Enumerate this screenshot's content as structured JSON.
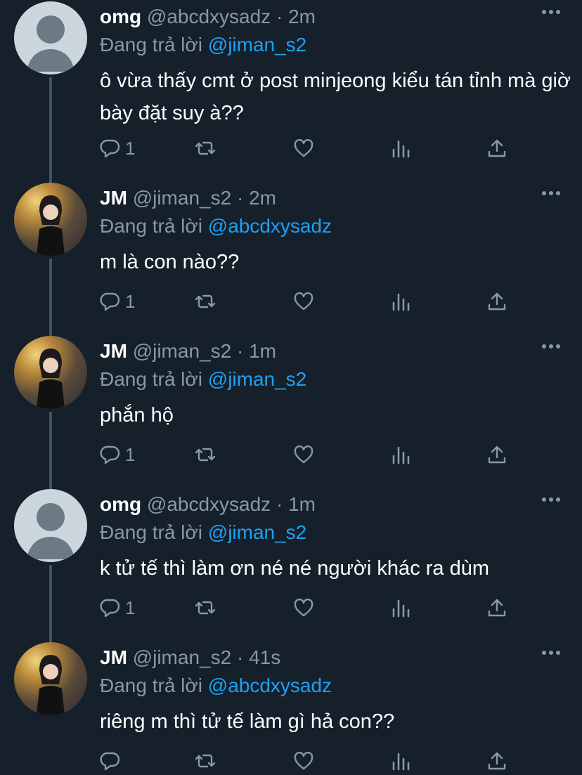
{
  "tweets": [
    {
      "name": "omg",
      "handle": "@abcdxysadz",
      "time": "2m",
      "replying_label": "Đang trả lời",
      "replying_to": "@jiman_s2",
      "text": "ô vừa thấy cmt ở post minjeong kiểu tán tỉnh mà giờ bày đặt suy à??",
      "reply_count": "1",
      "avatar": "default-avatar"
    },
    {
      "name": "JM",
      "handle": "@jiman_s2",
      "time": "2m",
      "replying_label": "Đang trả lời",
      "replying_to": "@abcdxysadz",
      "text": "m là con nào??",
      "reply_count": "1",
      "avatar": "photo-avatar"
    },
    {
      "name": "JM",
      "handle": "@jiman_s2",
      "time": "1m",
      "replying_label": "Đang trả lời",
      "replying_to": "@jiman_s2",
      "text": "phắn hộ",
      "reply_count": "1",
      "avatar": "photo-avatar"
    },
    {
      "name": "omg",
      "handle": "@abcdxysadz",
      "time": "1m",
      "replying_label": "Đang trả lời",
      "replying_to": "@jiman_s2",
      "text": "k tử tế thì làm ơn né né người khác ra dùm",
      "reply_count": "1",
      "avatar": "default-avatar"
    },
    {
      "name": "JM",
      "handle": "@jiman_s2",
      "time": "41s",
      "replying_label": "Đang trả lời",
      "replying_to": "@abcdxysadz",
      "text": "riêng m thì tử tế làm gì hả con??",
      "reply_count": "",
      "avatar": "photo-avatar"
    }
  ],
  "separator": " · ",
  "colors": {
    "background": "#15202b",
    "muted": "#8899a6",
    "link": "#1da1f2",
    "thread_line": "#3d5466"
  }
}
